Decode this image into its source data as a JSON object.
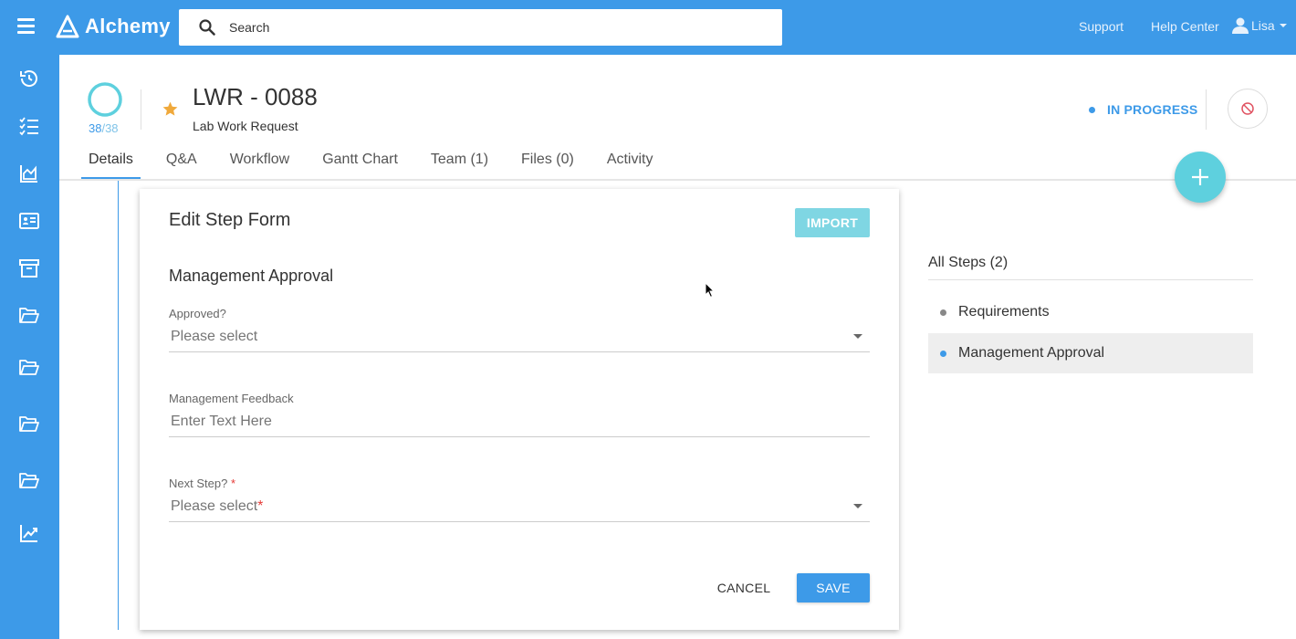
{
  "app": {
    "name": "Alchemy"
  },
  "topbar": {
    "search_placeholder": "Search",
    "links": [
      "Support",
      "Help Center"
    ],
    "user_name": "Lisa"
  },
  "sidebar": {
    "icons": [
      "history-icon",
      "checklist-icon",
      "chart-icon",
      "contact-card-icon",
      "archive-icon",
      "folder-icon",
      "folder-icon",
      "folder-icon",
      "folder-icon",
      "trending-icon"
    ]
  },
  "record": {
    "progress_done": "38",
    "progress_total": "/38",
    "progress_fraction": 1.0,
    "title": "LWR - 0088",
    "subtitle": "Lab Work Request",
    "status": "IN PROGRESS"
  },
  "tabs": [
    "Details",
    "Q&A",
    "Workflow",
    "Gantt Chart",
    "Team (1)",
    "Files (0)",
    "Activity"
  ],
  "active_tab": "Details",
  "form": {
    "title": "Edit Step Form",
    "import_label": "IMPORT",
    "section": "Management Approval",
    "approved_label": "Approved?",
    "approved_placeholder": "Please select",
    "feedback_label": "Management Feedback",
    "feedback_placeholder": "Enter Text Here",
    "next_step_label": "Next Step?",
    "next_step_placeholder": "Please select",
    "required_mark": "*",
    "cancel_label": "CANCEL",
    "save_label": "SAVE"
  },
  "steps": {
    "title": "All Steps (2)",
    "items": [
      "Requirements",
      "Management Approval"
    ],
    "active": "Management Approval"
  },
  "colors": {
    "primary": "#3d9ae8",
    "accent": "#5ed0de",
    "star": "#f0a93b",
    "required": "#e53935"
  }
}
